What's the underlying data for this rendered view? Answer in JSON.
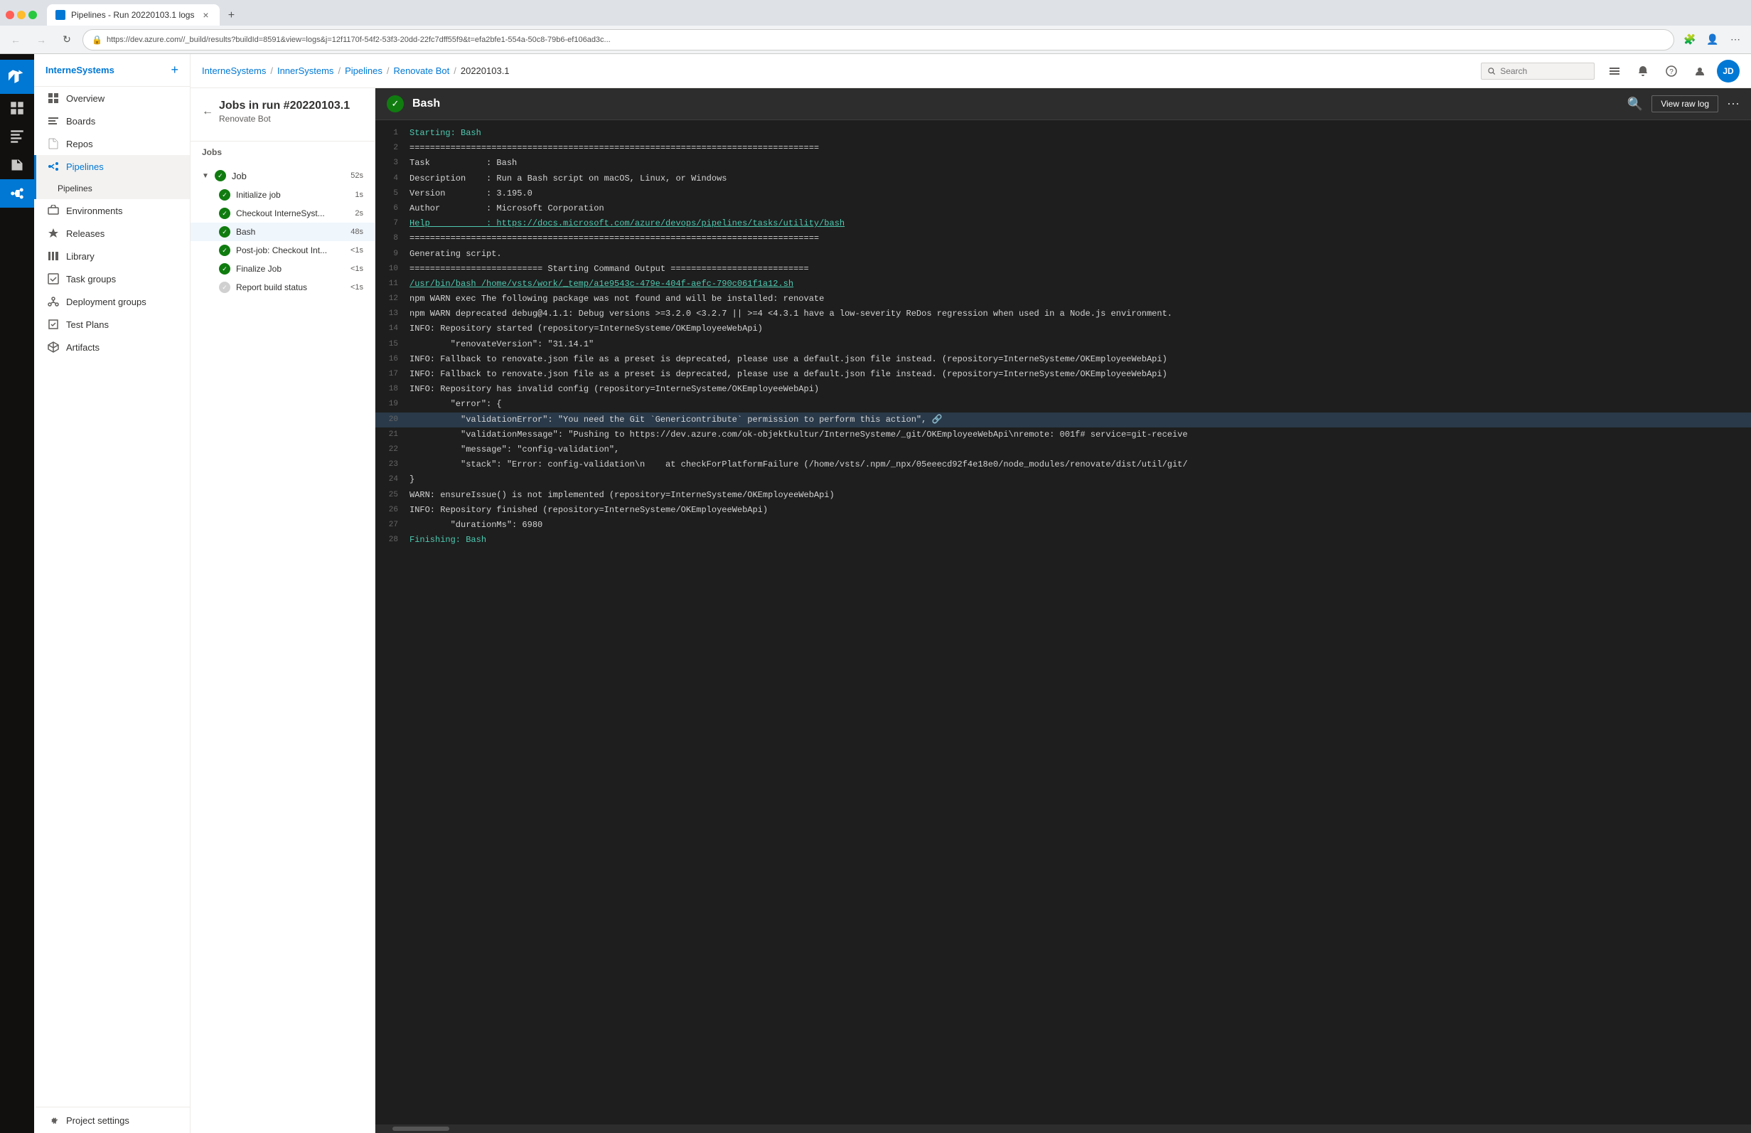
{
  "browser": {
    "tab_title": "Pipelines - Run 20220103.1 logs",
    "url": "https://dev.azure.com/​​​​​​​​​/_build/results?buildId=8591&view=logs&j=12f1170f-54f2-53f3-20dd-22fc7dff55f9&t=efa2bfe1-554a-50c8-79b6-ef106ad3c...",
    "new_tab_label": "+"
  },
  "top_header": {
    "org": "InterneSystems",
    "breadcrumbs": [
      "InterneSystems",
      "InnerSystems",
      "Pipelines",
      "Renovate Bot",
      "20220103.1"
    ],
    "search_placeholder": "Search",
    "icons": [
      "list",
      "bell",
      "question",
      "person",
      "avatar"
    ]
  },
  "sidebar": {
    "org_name": "InterneSystems",
    "items": [
      {
        "label": "Overview",
        "icon": "home"
      },
      {
        "label": "Boards",
        "icon": "boards"
      },
      {
        "label": "Repos",
        "icon": "repos"
      },
      {
        "label": "Pipelines",
        "icon": "pipelines",
        "active": true
      },
      {
        "label": "Environments",
        "icon": "environments"
      },
      {
        "label": "Releases",
        "icon": "releases"
      },
      {
        "label": "Library",
        "icon": "library"
      },
      {
        "label": "Task groups",
        "icon": "taskgroups"
      },
      {
        "label": "Deployment groups",
        "icon": "deploymentgroups"
      },
      {
        "label": "Test Plans",
        "icon": "testplans"
      },
      {
        "label": "Artifacts",
        "icon": "artifacts"
      }
    ],
    "settings_label": "Project settings"
  },
  "jobs_panel": {
    "back_label": "←",
    "title": "Jobs in run #20220103.1",
    "subtitle": "Renovate Bot",
    "section_label": "Jobs",
    "job": {
      "name": "Job",
      "duration": "52s",
      "steps": [
        {
          "name": "Initialize job",
          "duration": "1s",
          "status": "success"
        },
        {
          "name": "Checkout InterneSyst...",
          "duration": "2s",
          "status": "success"
        },
        {
          "name": "Bash",
          "duration": "48s",
          "status": "success",
          "active": true
        },
        {
          "name": "Post-job: Checkout Int...",
          "duration": "<1s",
          "status": "success"
        },
        {
          "name": "Finalize Job",
          "duration": "<1s",
          "status": "success"
        },
        {
          "name": "Report build status",
          "duration": "<1s",
          "status": "partial"
        }
      ]
    }
  },
  "log": {
    "task_name": "Bash",
    "view_raw_label": "View raw log",
    "lines": [
      {
        "num": 1,
        "text": "Starting: Bash",
        "style": "green"
      },
      {
        "num": 2,
        "text": "================================================================================",
        "style": "dim"
      },
      {
        "num": 3,
        "text": "Task           : Bash",
        "style": "normal"
      },
      {
        "num": 4,
        "text": "Description    : Run a Bash script on macOS, Linux, or Windows",
        "style": "normal"
      },
      {
        "num": 5,
        "text": "Version        : 3.195.0",
        "style": "normal"
      },
      {
        "num": 6,
        "text": "Author         : Microsoft Corporation",
        "style": "normal"
      },
      {
        "num": 7,
        "text": "Help           : https://docs.microsoft.com/azure/devops/pipelines/tasks/utility/bash",
        "style": "link"
      },
      {
        "num": 8,
        "text": "================================================================================",
        "style": "dim"
      },
      {
        "num": 9,
        "text": "Generating script.",
        "style": "normal"
      },
      {
        "num": 10,
        "text": "========================== Starting Command Output ===========================",
        "style": "dim"
      },
      {
        "num": 11,
        "text": "/usr/bin/bash /home/vsts/work/_temp/a1e9543c-479e-404f-aefc-790c061f1a12.sh",
        "style": "link"
      },
      {
        "num": 12,
        "text": "npm WARN exec The following package was not found and will be installed: renovate",
        "style": "normal"
      },
      {
        "num": 13,
        "text": "npm WARN deprecated debug@4.1.1: Debug versions >=3.2.0 <3.2.7 || >=4 <4.3.1 have a low-severity ReDos regression when used in a Node.js environment.",
        "style": "normal"
      },
      {
        "num": 14,
        "text": "INFO: Repository started (repository=InterneSysteme/OKEmployeeWebApi)",
        "style": "normal"
      },
      {
        "num": 15,
        "text": "        \"renovateVersion\": \"31.14.1\"",
        "style": "normal"
      },
      {
        "num": 16,
        "text": "INFO: Fallback to renovate.json file as a preset is deprecated, please use a default.json file instead. (repository=InterneSysteme/OKEmployeeWebApi)",
        "style": "normal"
      },
      {
        "num": 17,
        "text": "INFO: Fallback to renovate.json file as a preset is deprecated, please use a default.json file instead. (repository=InterneSysteme/OKEmployeeWebApi)",
        "style": "normal"
      },
      {
        "num": 18,
        "text": "INFO: Repository has invalid config (repository=InterneSysteme/OKEmployeeWebApi)",
        "style": "normal"
      },
      {
        "num": 19,
        "text": "        \"error\": {",
        "style": "normal"
      },
      {
        "num": 20,
        "text": "          \"validationError\": \"You need the Git `Genericontribute` permission to perform this action\", 🔗",
        "style": "highlighted"
      },
      {
        "num": 21,
        "text": "          \"validationMessage\": \"Pushing to https://dev.azure.com/ok-objektkultur/InterneSysteme/_git/OKEmployeeWebApi\\nremote: 001f# service=git-receive",
        "style": "normal"
      },
      {
        "num": 22,
        "text": "          \"message\": \"config-validation\",",
        "style": "normal"
      },
      {
        "num": 23,
        "text": "          \"stack\": \"Error: config-validation\\n    at checkForPlatformFailure (/home/vsts/.npm/_npx/05eeecd92f4e18e0/node_modules/renovate/dist/util/git/",
        "style": "normal"
      },
      {
        "num": 24,
        "text": "}",
        "style": "normal"
      },
      {
        "num": 25,
        "text": "WARN: ensureIssue() is not implemented (repository=InterneSysteme/OKEmployeeWebApi)",
        "style": "normal"
      },
      {
        "num": 26,
        "text": "INFO: Repository finished (repository=InterneSysteme/OKEmployeeWebApi)",
        "style": "normal"
      },
      {
        "num": 27,
        "text": "        \"durationMs\": 6980",
        "style": "normal"
      },
      {
        "num": 28,
        "text": "Finishing: Bash",
        "style": "green"
      }
    ]
  }
}
